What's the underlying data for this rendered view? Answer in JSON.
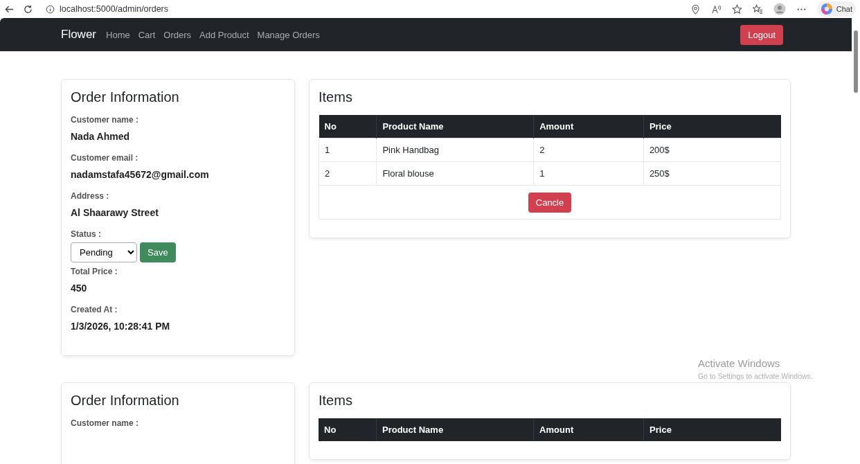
{
  "browser": {
    "url": "localhost:5000/admin/orders",
    "chat_label": "Chat"
  },
  "navbar": {
    "brand": "Flower",
    "links": [
      "Home",
      "Cart",
      "Orders",
      "Add Product",
      "Manage Orders"
    ],
    "logout": "Logout"
  },
  "orders": [
    {
      "info_title": "Order Information",
      "fields": [
        {
          "label": "Customer name :",
          "value": "Nada Ahmed"
        },
        {
          "label": "Customer email :",
          "value": "nadamstafa45672@gmail.com"
        },
        {
          "label": "Address :",
          "value": "Al Shaarawy Street"
        }
      ],
      "status": {
        "label": "Status :",
        "value": "Pending",
        "save": "Save"
      },
      "after_fields": [
        {
          "label": "Total Price :",
          "value": "450"
        },
        {
          "label": "Created At :",
          "value": "1/3/2026, 10:28:41 PM"
        }
      ],
      "items_title": "Items",
      "columns": [
        "No",
        "Product Name",
        "Amount",
        "Price"
      ],
      "rows": [
        [
          "1",
          "Pink Handbag",
          "2",
          "200$"
        ],
        [
          "2",
          "Floral blouse",
          "1",
          "250$"
        ]
      ],
      "cancel": "Cancle"
    },
    {
      "info_title": "Order Information",
      "fields": [
        {
          "label": "Customer name :"
        }
      ],
      "items_title": "Items",
      "columns": [
        "No",
        "Product Name",
        "Amount",
        "Price"
      ]
    }
  ],
  "os_overlay": {
    "title": "Activate Windows",
    "subtitle": "Go to Settings to activate Windows."
  }
}
